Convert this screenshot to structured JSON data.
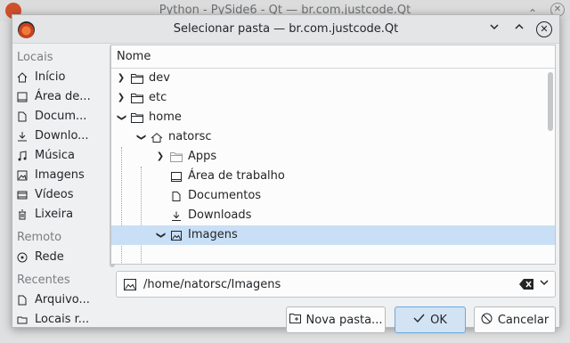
{
  "background_window": {
    "title": "Python - PySide6 - Qt — br.com.justcode.Qt",
    "controls": [
      "chevron-down-icon",
      "chevron-up-icon",
      "close-icon"
    ]
  },
  "dialog": {
    "title": "Selecionar pasta — br.com.justcode.Qt",
    "controls": [
      "chevron-down-icon",
      "chevron-up-icon",
      "close-icon"
    ]
  },
  "sidebar": {
    "sections": [
      {
        "label": "Locais",
        "items": [
          {
            "label": "Início",
            "icon": "home-icon"
          },
          {
            "label": "Área de...",
            "icon": "desktop-icon"
          },
          {
            "label": "Docum...",
            "icon": "documents-icon"
          },
          {
            "label": "Downlo...",
            "icon": "download-icon"
          },
          {
            "label": "Música",
            "icon": "music-icon"
          },
          {
            "label": "Imagens",
            "icon": "image-icon"
          },
          {
            "label": "Vídeos",
            "icon": "video-icon"
          },
          {
            "label": "Lixeira",
            "icon": "trash-icon"
          }
        ]
      },
      {
        "label": "Remoto",
        "items": [
          {
            "label": "Rede",
            "icon": "network-icon"
          }
        ]
      },
      {
        "label": "Recentes",
        "items": [
          {
            "label": "Arquivo...",
            "icon": "recent-file-icon"
          },
          {
            "label": "Locais r...",
            "icon": "recent-location-icon"
          }
        ]
      }
    ]
  },
  "tree": {
    "header": "Nome",
    "rows": [
      {
        "label": "dev",
        "level": 0,
        "expanded": false,
        "icon": "folder-icon"
      },
      {
        "label": "etc",
        "level": 0,
        "expanded": false,
        "icon": "folder-icon"
      },
      {
        "label": "home",
        "level": 0,
        "expanded": true,
        "icon": "folder-icon"
      },
      {
        "label": "natorsc",
        "level": 1,
        "expanded": true,
        "icon": "home-icon"
      },
      {
        "label": "Apps",
        "level": 2,
        "expanded": false,
        "icon": "folder-icon"
      },
      {
        "label": "Área de trabalho",
        "level": 2,
        "expanded": null,
        "icon": "desktop-icon"
      },
      {
        "label": "Documentos",
        "level": 2,
        "expanded": null,
        "icon": "documents-icon"
      },
      {
        "label": "Downloads",
        "level": 2,
        "expanded": null,
        "icon": "download-icon"
      },
      {
        "label": "Imagens",
        "level": 2,
        "expanded": true,
        "icon": "image-icon",
        "selected": true
      }
    ]
  },
  "path": {
    "value": "/home/natorsc/Imagens"
  },
  "buttons": {
    "new_folder": "Nova pasta...",
    "ok": "OK",
    "cancel": "Cancelar"
  },
  "colors": {
    "selection": "#c9dff5",
    "primary_border": "#6aa8de",
    "app_icon": "#d0502c"
  }
}
